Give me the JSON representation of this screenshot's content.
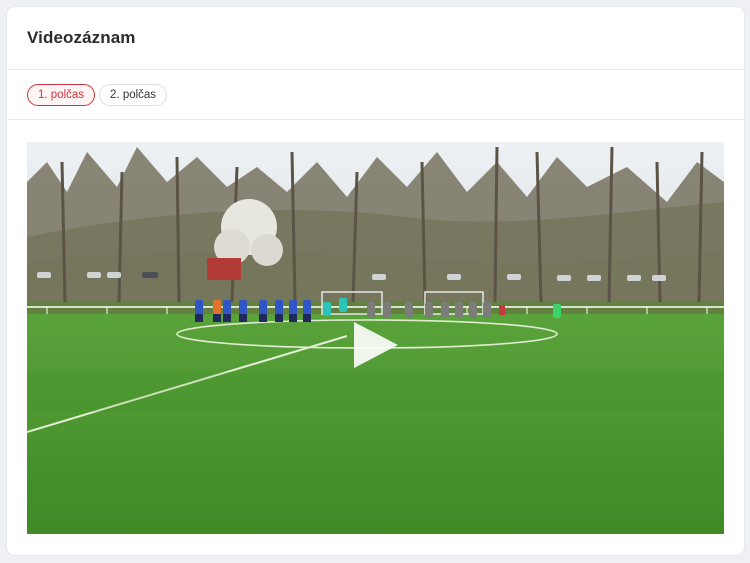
{
  "section": {
    "title": "Videozáznam"
  },
  "tabs": [
    {
      "label": "1. polčas",
      "active": true
    },
    {
      "label": "2. polčas",
      "active": false
    }
  ],
  "video": {
    "thumbnail_description_icon": "play-icon",
    "colors": {
      "sky": "#e9edf1",
      "trees": "#6f6b5a",
      "hill": "#6f8c4d",
      "grass": "#4f9a31",
      "team_home": "#2f55c8",
      "team_away": "#7c7c78",
      "accent": "#d0343c"
    }
  }
}
